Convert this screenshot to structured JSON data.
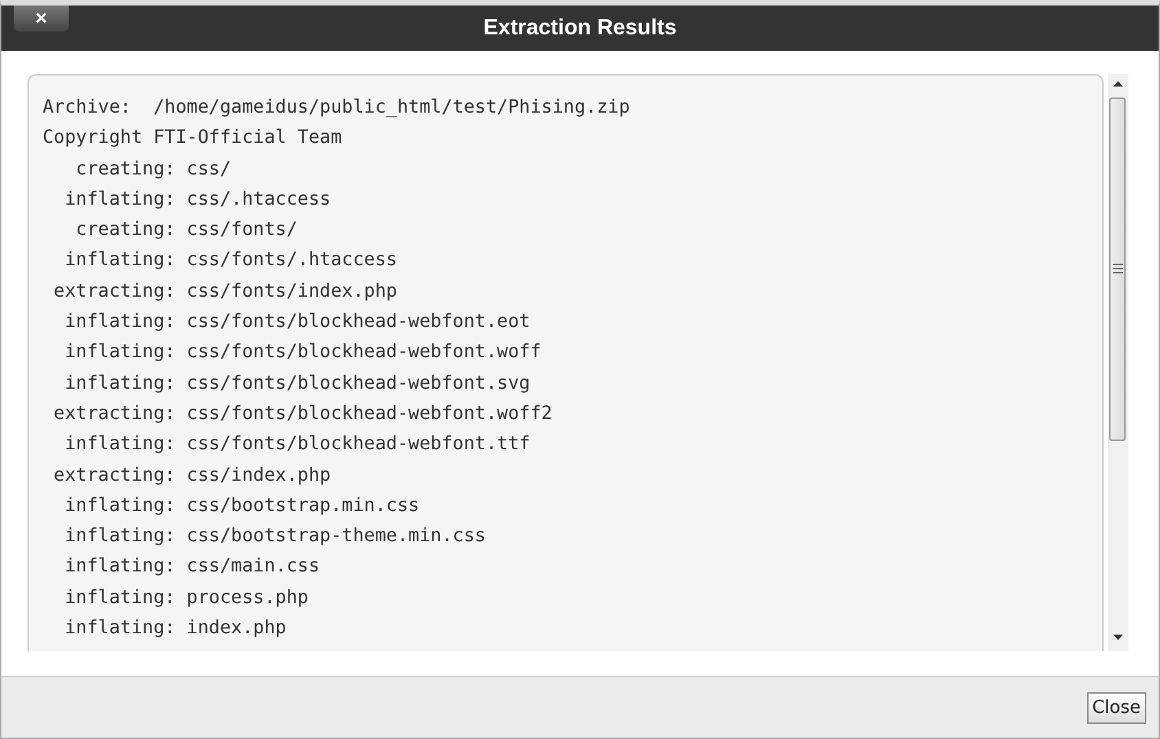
{
  "dialog": {
    "title": "Extraction Results",
    "close_icon": "×",
    "close_button": "Close"
  },
  "output_lines": [
    "Archive:  /home/gameidus/public_html/test/Phising.zip",
    "Copyright FTI-Official Team",
    "   creating: css/",
    "  inflating: css/.htaccess",
    "   creating: css/fonts/",
    "  inflating: css/fonts/.htaccess",
    " extracting: css/fonts/index.php",
    "  inflating: css/fonts/blockhead-webfont.eot",
    "  inflating: css/fonts/blockhead-webfont.woff",
    "  inflating: css/fonts/blockhead-webfont.svg",
    " extracting: css/fonts/blockhead-webfont.woff2",
    "  inflating: css/fonts/blockhead-webfont.ttf",
    " extracting: css/index.php",
    "  inflating: css/bootstrap.min.css",
    "  inflating: css/bootstrap-theme.min.css",
    "  inflating: css/main.css",
    "  inflating: process.php",
    "  inflating: index.php"
  ]
}
